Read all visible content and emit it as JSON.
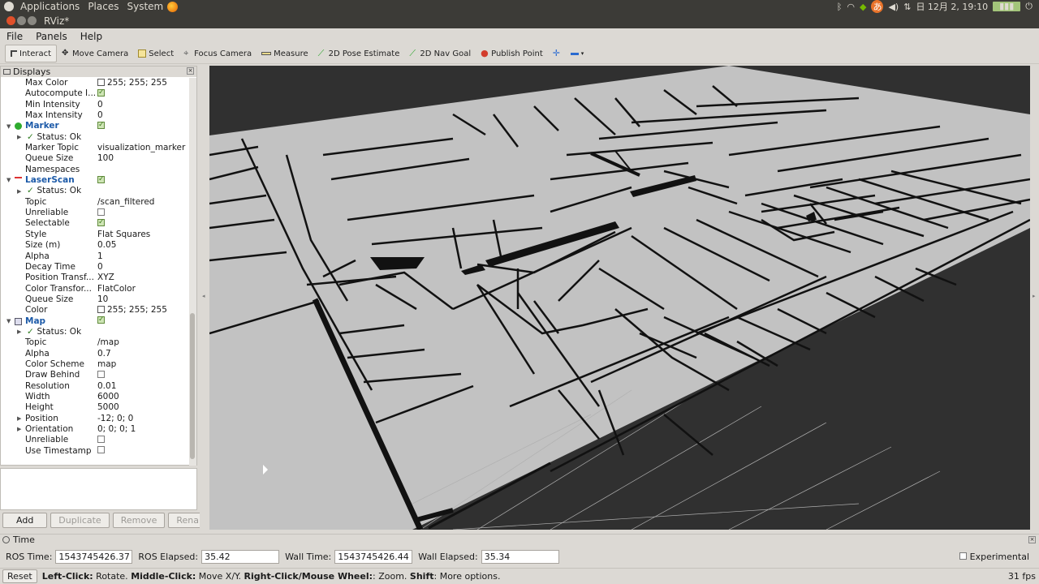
{
  "top_panel": {
    "menus": [
      "Applications",
      "Places",
      "System"
    ],
    "clock": "日 12月  2, 19:10"
  },
  "window": {
    "title": "RViz*"
  },
  "menu_bar": [
    "File",
    "Panels",
    "Help"
  ],
  "toolbar": {
    "tools": [
      {
        "label": "Interact",
        "icon": "cursor-icon",
        "active": true
      },
      {
        "label": "Move Camera",
        "icon": "move-camera-icon"
      },
      {
        "label": "Select",
        "icon": "select-icon"
      },
      {
        "label": "Focus Camera",
        "icon": "focus-camera-icon"
      },
      {
        "label": "Measure",
        "icon": "ruler-icon"
      },
      {
        "label": "2D Pose Estimate",
        "icon": "green-arrow-icon"
      },
      {
        "label": "2D Nav Goal",
        "icon": "green-arrow-icon"
      },
      {
        "label": "Publish Point",
        "icon": "map-pin-icon"
      }
    ]
  },
  "displays": {
    "title": "Displays",
    "rows": [
      {
        "indent": 1,
        "name": "Max Color",
        "value": "255; 255; 255",
        "swatch": "#ffffff"
      },
      {
        "indent": 1,
        "name": "Autocompute I...",
        "check": true
      },
      {
        "indent": 1,
        "name": "Min Intensity",
        "value": "0"
      },
      {
        "indent": 1,
        "name": "Max Intensity",
        "value": "0"
      },
      {
        "indent": 0,
        "name": "Marker",
        "check": true,
        "bold": true,
        "expander": "open",
        "icon": "marker-icon"
      },
      {
        "indent": 1,
        "name": "Status: Ok",
        "expander": "closed",
        "ok": true
      },
      {
        "indent": 1,
        "name": "Marker Topic",
        "value": "visualization_marker"
      },
      {
        "indent": 1,
        "name": "Queue Size",
        "value": "100"
      },
      {
        "indent": 1,
        "name": "Namespaces",
        "value": ""
      },
      {
        "indent": 0,
        "name": "LaserScan",
        "check": true,
        "bold": true,
        "expander": "open",
        "icon": "laserscan-icon"
      },
      {
        "indent": 1,
        "name": "Status: Ok",
        "expander": "closed",
        "ok": true
      },
      {
        "indent": 1,
        "name": "Topic",
        "value": "/scan_filtered"
      },
      {
        "indent": 1,
        "name": "Unreliable",
        "check": false
      },
      {
        "indent": 1,
        "name": "Selectable",
        "check": true
      },
      {
        "indent": 1,
        "name": "Style",
        "value": "Flat Squares"
      },
      {
        "indent": 1,
        "name": "Size (m)",
        "value": "0.05"
      },
      {
        "indent": 1,
        "name": "Alpha",
        "value": "1"
      },
      {
        "indent": 1,
        "name": "Decay Time",
        "value": "0"
      },
      {
        "indent": 1,
        "name": "Position Transf...",
        "value": "XYZ"
      },
      {
        "indent": 1,
        "name": "Color Transfor...",
        "value": "FlatColor"
      },
      {
        "indent": 1,
        "name": "Queue Size",
        "value": "10"
      },
      {
        "indent": 1,
        "name": "Color",
        "value": "255; 255; 255",
        "swatch": "#ffffff"
      },
      {
        "indent": 0,
        "name": "Map",
        "check": true,
        "bold": true,
        "expander": "open",
        "icon": "map-icon"
      },
      {
        "indent": 1,
        "name": "Status: Ok",
        "expander": "closed",
        "ok": true
      },
      {
        "indent": 1,
        "name": "Topic",
        "value": "/map"
      },
      {
        "indent": 1,
        "name": "Alpha",
        "value": "0.7"
      },
      {
        "indent": 1,
        "name": "Color Scheme",
        "value": "map"
      },
      {
        "indent": 1,
        "name": "Draw Behind",
        "check": false
      },
      {
        "indent": 1,
        "name": "Resolution",
        "value": "0.01"
      },
      {
        "indent": 1,
        "name": "Width",
        "value": "6000"
      },
      {
        "indent": 1,
        "name": "Height",
        "value": "5000"
      },
      {
        "indent": 1,
        "name": "Position",
        "value": "-12; 0; 0",
        "expander": "closed"
      },
      {
        "indent": 1,
        "name": "Orientation",
        "value": "0; 0; 0; 1",
        "expander": "closed"
      },
      {
        "indent": 1,
        "name": "Unreliable",
        "check": false
      },
      {
        "indent": 1,
        "name": "Use Timestamp",
        "check": false
      }
    ],
    "buttons": [
      {
        "label": "Add",
        "enabled": true
      },
      {
        "label": "Duplicate",
        "enabled": false
      },
      {
        "label": "Remove",
        "enabled": false
      },
      {
        "label": "Rename",
        "enabled": false
      }
    ]
  },
  "time": {
    "title": "Time",
    "ros_time_label": "ROS Time:",
    "ros_time": "1543745426.37",
    "ros_elapsed_label": "ROS Elapsed:",
    "ros_elapsed": "35.42",
    "wall_time_label": "Wall Time:",
    "wall_time": "1543745426.44",
    "wall_elapsed_label": "Wall Elapsed:",
    "wall_elapsed": "35.34",
    "experimental_label": "Experimental"
  },
  "status_bar": {
    "reset_label": "Reset",
    "left_click": "Left-Click:",
    "left_click_desc": " Rotate. ",
    "middle_click": "Middle-Click:",
    "middle_click_desc": " Move X/Y. ",
    "right_click": "Right-Click/Mouse Wheel:",
    "right_click_desc": ": Zoom. ",
    "shift": "Shift",
    "shift_desc": ": More options.",
    "fps": "31 fps"
  },
  "colors": {
    "map_floor": "#c2c2c2",
    "background": "#303030",
    "wall": "#111111",
    "link_blue": "#1c5aa8"
  }
}
